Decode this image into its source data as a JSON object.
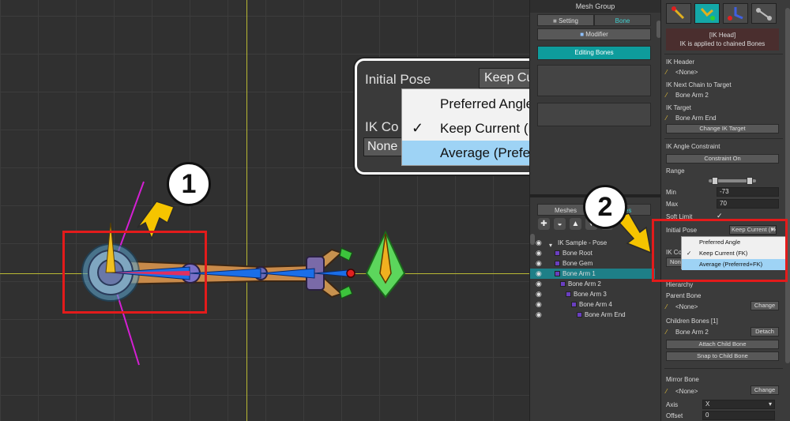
{
  "mesh_panel": {
    "title": "Mesh Group",
    "tabs": [
      "Setting",
      "Bone"
    ],
    "modifier_label": "Modifier",
    "editing_label": "Editing Bones",
    "list_tabs": [
      "Meshes",
      "Bones"
    ],
    "tree": [
      {
        "label": "IK Sample - Pose",
        "indent": 0,
        "selected": false
      },
      {
        "label": "Bone Root",
        "indent": 1,
        "selected": false
      },
      {
        "label": "Bone Gem",
        "indent": 1,
        "selected": false
      },
      {
        "label": "Bone Arm 1",
        "indent": 1,
        "selected": true
      },
      {
        "label": "Bone Arm 2",
        "indent": 2,
        "selected": false
      },
      {
        "label": "Bone Arm 3",
        "indent": 3,
        "selected": false
      },
      {
        "label": "Bone Arm 4",
        "indent": 4,
        "selected": false
      },
      {
        "label": "Bone Arm End",
        "indent": 5,
        "selected": false
      }
    ]
  },
  "props": {
    "ik_head_title": "[IK Head]",
    "ik_head_desc": "IK is applied to chained Bones",
    "ik_header_label": "IK Header",
    "ik_header_value": "<None>",
    "ik_next_label": "IK Next Chain to Target",
    "ik_next_value": "Bone Arm 2",
    "ik_target_label": "IK Target",
    "ik_target_value": "Bone Arm End",
    "change_ik_target": "Change IK Target",
    "ik_angle_label": "IK Angle Constraint",
    "constraint_on": "Constraint On",
    "range_label": "Range",
    "min_label": "Min",
    "min_value": "-73",
    "max_label": "Max",
    "max_value": "70",
    "soft_limit_label": "Soft Limit",
    "initial_pose_label": "Initial Pose",
    "initial_pose_value": "Keep Current (Fk",
    "ik_con_label": "IK Co",
    "none_btn": "None",
    "hierarchy_label": "Hierarchy",
    "parent_bone_label": "Parent Bone",
    "parent_bone_value": "<None>",
    "change": "Change",
    "children_label": "Children Bones [1]",
    "children_value": "Bone Arm 2",
    "detach": "Detach",
    "attach_child": "Attach Child Bone",
    "snap_child": "Snap to Child Bone",
    "mirror_label": "Mirror Bone",
    "mirror_value": "<None>",
    "axis_label": "Axis",
    "axis_value": "X",
    "offset_label": "Offset",
    "offset_value": "0"
  },
  "dropdown": {
    "options": [
      "Preferred Angle",
      "Keep Current (FK)",
      "Average (Preferred+FK)"
    ],
    "checked_index": 1,
    "highlight_index": 2
  },
  "zoom": {
    "initial_pose_label": "Initial Pose",
    "current_value": "Keep Current (FK",
    "ik_co_label": "IK Co",
    "none_label": "None"
  },
  "annotations": [
    "1",
    "2"
  ],
  "colors": {
    "accent_teal": "#0e9c9c",
    "highlight_red": "#e31b1b",
    "arrow_yellow": "#f5c400"
  }
}
